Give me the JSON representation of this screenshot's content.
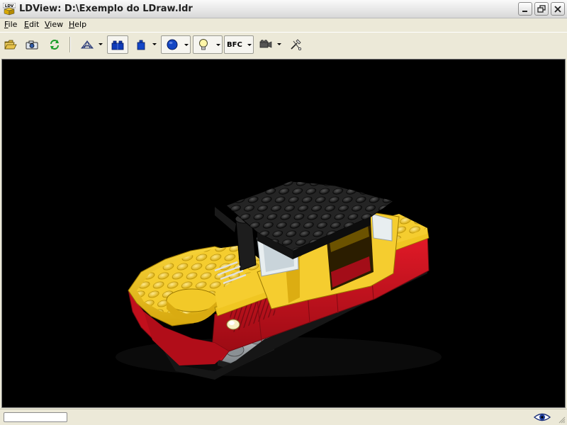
{
  "window": {
    "title": "LDView: D:\\Exemplo do LDraw.ldr",
    "app_icon_label": "LDV",
    "buttons": [
      "minimize",
      "restore",
      "close"
    ]
  },
  "menu": {
    "items": [
      {
        "label": "File"
      },
      {
        "label": "Edit"
      },
      {
        "label": "View"
      },
      {
        "label": "Help"
      }
    ]
  },
  "toolbar": {
    "buttons": [
      {
        "icon": "open-folder-icon"
      },
      {
        "icon": "camera-snapshot-icon"
      },
      {
        "icon": "reload-icon"
      },
      {
        "icon": "wireframe-icon",
        "has_dropdown": true
      },
      {
        "icon": "seams-icon",
        "pressed": true
      },
      {
        "icon": "edges-icon",
        "has_dropdown": true
      },
      {
        "icon": "primitive-substitution-icon",
        "pressed": true,
        "has_dropdown": true
      },
      {
        "icon": "lighting-icon",
        "pressed": true,
        "has_dropdown": true
      },
      {
        "icon": "bfc-icon",
        "pressed": true,
        "has_dropdown": true
      },
      {
        "icon": "view-angle-icon",
        "has_dropdown": true
      },
      {
        "icon": "preferences-icon"
      }
    ],
    "bfc_label": "BFC"
  },
  "viewport": {
    "background": "#000000",
    "model_colors": {
      "yellow": "#f5cd2f",
      "red": "#d0101e",
      "black": "#1a1a1a",
      "gray": "#a0a5a9",
      "trans_clear": "#dfe9ee"
    }
  },
  "statusbar": {
    "progress": 0,
    "icon": "eye-icon"
  }
}
